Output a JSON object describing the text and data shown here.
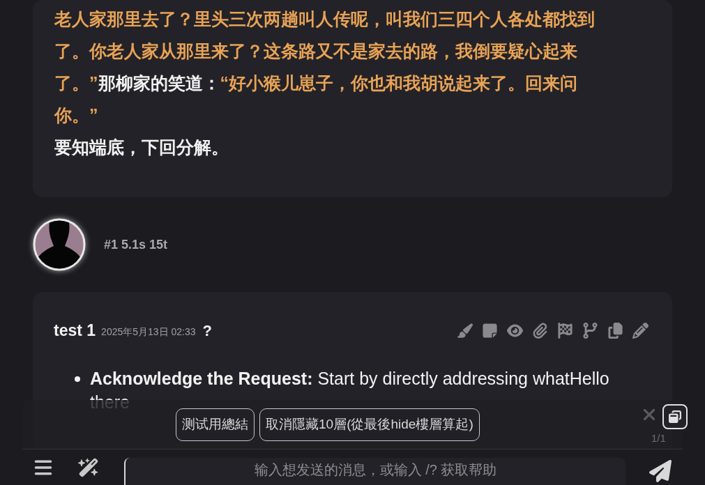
{
  "story_card": {
    "paragraphs": [
      {
        "segments": [
          {
            "kind": "quote",
            "text": "老人家那里去了？里头三次两趟叫人传呢，叫我们三四个人各处都找到了。你老人家从那里来了？这条路又不是家去的路，我倒要疑心起来了。”"
          },
          {
            "kind": "narration",
            "text": "那柳家的笑道："
          },
          {
            "kind": "quote",
            "text": "“好小猴儿崽子，你也和我胡说起来了。回来问你。”"
          }
        ]
      },
      {
        "segments": [
          {
            "kind": "narration",
            "text": "要知端底，下回分解。"
          }
        ]
      }
    ]
  },
  "message_meta": {
    "text": "#1 5.1s 15t"
  },
  "message": {
    "name": "test 1",
    "date": "2025年5月13日 02:33",
    "flag": "?",
    "bullets": [
      "**Acknowledge the Request:** Start by directly addressing whatHello there"
    ]
  },
  "quick_replies": [
    "测试用總結",
    "取消隱藏10層(從最後hide樓層算起)"
  ],
  "swipe_counter": "1/1",
  "input": {
    "placeholder": "输入想发送的消息，或输入 /? 获取帮助"
  }
}
